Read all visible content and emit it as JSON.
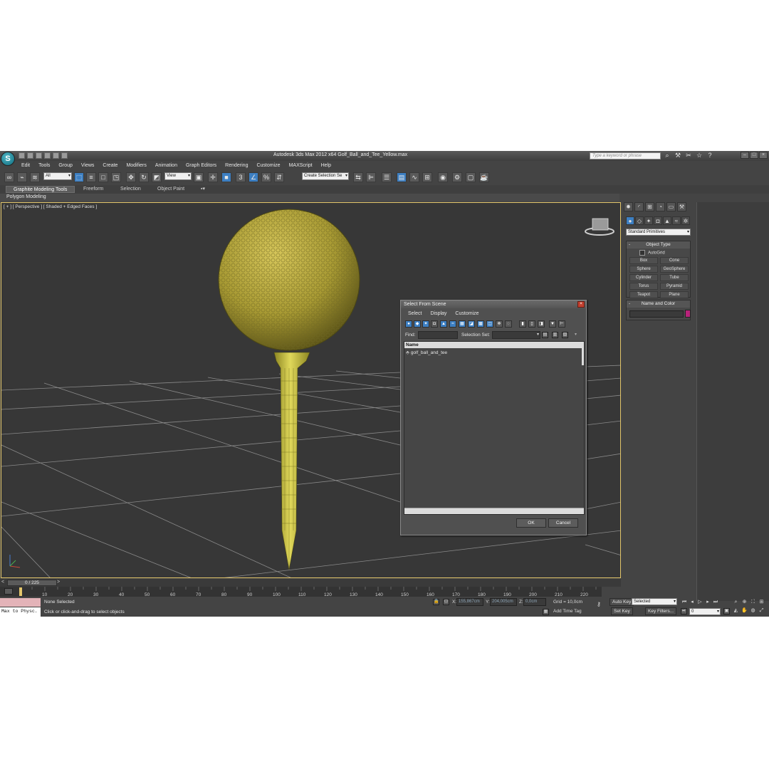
{
  "app": {
    "window_title": "Autodesk 3ds Max  2012 x64     Golf_Ball_and_Tee_Yellow.max",
    "logo_letter": "S",
    "search_placeholder": "Type a keyword or phrase"
  },
  "menu": [
    "Edit",
    "Tools",
    "Group",
    "Views",
    "Create",
    "Modifiers",
    "Animation",
    "Graph Editors",
    "Rendering",
    "Customize",
    "MAXScript",
    "Help"
  ],
  "toolbar": {
    "filter_value": "All",
    "ref_coord_value": "View",
    "named_selection_placeholder": "Create Selection Se"
  },
  "ribbon": {
    "tabs": [
      "Graphite Modeling Tools",
      "Freeform",
      "Selection",
      "Object Paint"
    ],
    "sub_label": "Polygon Modeling"
  },
  "viewport": {
    "label": "[ + ] [ Perspective ] [ Shaded + Edged Faces ]"
  },
  "dialog": {
    "title": "Select From Scene",
    "menu": [
      "Select",
      "Display",
      "Customize"
    ],
    "find_label": "Find:",
    "selection_set_label": "Selection Set:",
    "column_header": "Name",
    "items": [
      "golf_ball_and_tee"
    ],
    "ok_label": "OK",
    "cancel_label": "Cancel"
  },
  "command_panel": {
    "dropdown_value": "Standard Primitives",
    "object_type_title": "Object Type",
    "autogrid_label": "AutoGrid",
    "primitives": [
      "Box",
      "Cone",
      "Sphere",
      "GeoSphere",
      "Cylinder",
      "Tube",
      "Torus",
      "Pyramid",
      "Teapot",
      "Plane"
    ],
    "name_color_title": "Name and Color",
    "object_color": "#b8227a"
  },
  "timeline": {
    "frame_display": "0 / 225",
    "ruler_ticks": [
      "10",
      "20",
      "30",
      "40",
      "50",
      "60",
      "70",
      "80",
      "90",
      "100",
      "110",
      "120",
      "130",
      "140",
      "150",
      "160",
      "170",
      "180",
      "190",
      "200",
      "210",
      "220"
    ]
  },
  "status": {
    "selection_text": "None Selected",
    "prompt_text": "Click or click-and-drag to select objects",
    "script_listener": "Max to Physc.",
    "x_label": "X:",
    "x_value": "155,867cm",
    "y_label": "Y:",
    "y_value": "204,005cm",
    "z_label": "Z:",
    "z_value": "0,0cm",
    "grid_text": "Grid = 10,0cm",
    "add_time_tag": "Add Time Tag"
  },
  "animation": {
    "auto_key_label": "Auto Key",
    "set_key_label": "Set Key",
    "key_mode_value": "Selected",
    "key_filters_label": "Key Filters...",
    "frame_value": "0"
  },
  "colors": {
    "viewport_border": "#e3c66b",
    "ball": "#b8a83a",
    "tee": "#d0c850",
    "accent_blue": "#3d7fc2"
  }
}
